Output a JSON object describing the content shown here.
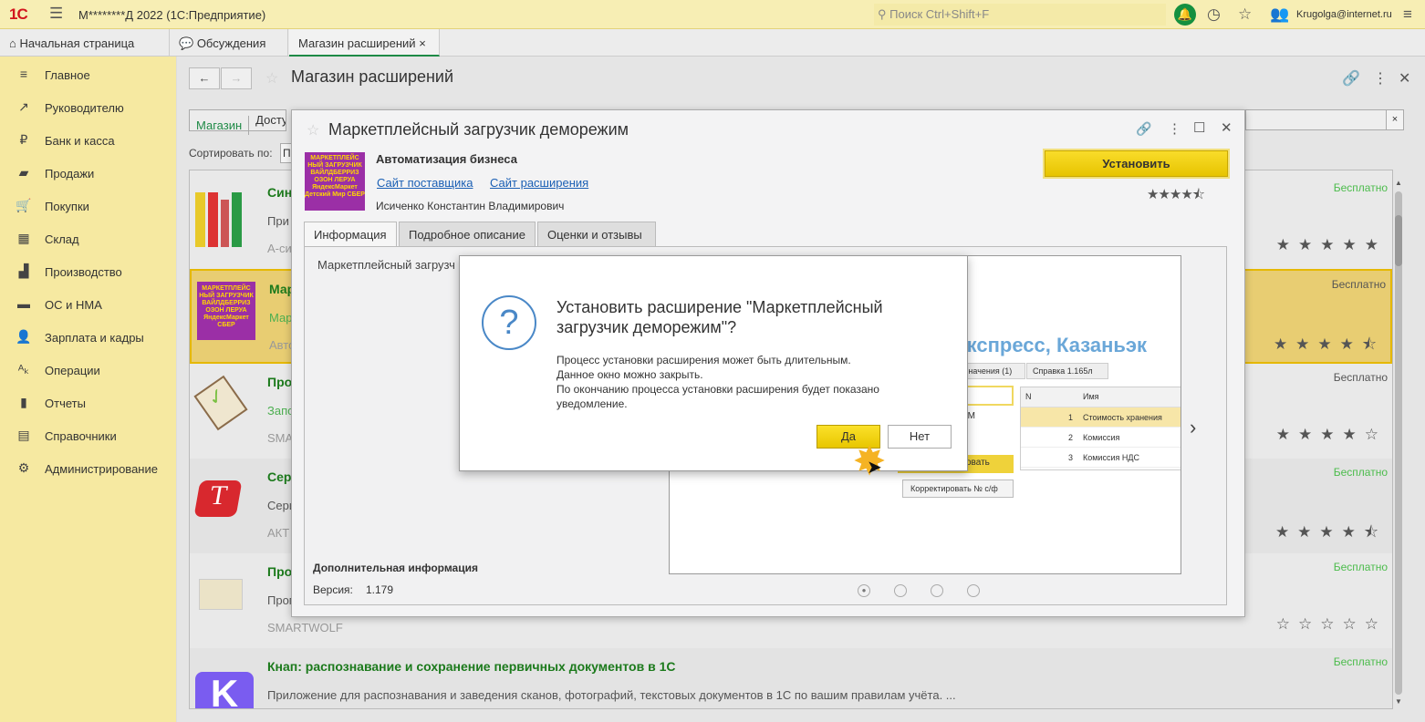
{
  "header": {
    "app_title": "М********Д 2022  (1С:Предприятие)",
    "search_placeholder": "Поиск Ctrl+Shift+F",
    "user": "Krugolga@internet.ru",
    "logo": "1С"
  },
  "tabs": [
    {
      "label": "Начальная страница"
    },
    {
      "label": "Обсуждения"
    },
    {
      "label": "Магазин расширений",
      "close": "×"
    }
  ],
  "sidebar": {
    "items": [
      {
        "label": "Главное",
        "icon": "≡"
      },
      {
        "label": "Руководителю",
        "icon": "↗"
      },
      {
        "label": "Банк и касса",
        "icon": "₽"
      },
      {
        "label": "Продажи",
        "icon": "▰"
      },
      {
        "label": "Покупки",
        "icon": "🛒"
      },
      {
        "label": "Склад",
        "icon": "▦"
      },
      {
        "label": "Производство",
        "icon": "▟"
      },
      {
        "label": "ОС и НМА",
        "icon": "▬"
      },
      {
        "label": "Зарплата и кадры",
        "icon": "👤"
      },
      {
        "label": "Операции",
        "icon": "ᴬₖ"
      },
      {
        "label": "Отчеты",
        "icon": "▮"
      },
      {
        "label": "Справочники",
        "icon": "▤"
      },
      {
        "label": "Администрирование",
        "icon": "⚙"
      }
    ]
  },
  "page": {
    "title": "Магазин расширений",
    "filter_tabs": [
      "Магазин",
      "Досту"
    ],
    "sort_label": "Сортировать по:",
    "sort_value": "П"
  },
  "list": [
    {
      "title": "Син",
      "subtitle": "При",
      "vendor": "А-си",
      "price": "Бесплатно",
      "rating": 5
    },
    {
      "title": "Мар",
      "subtitle": "Мар",
      "vendor": "Авто",
      "price": "Бесплатно",
      "rating": 4.5
    },
    {
      "title": "Про",
      "subtitle": "Запо",
      "vendor": "SMA",
      "price": "Бесплатно",
      "rating": 4
    },
    {
      "title": "Сер",
      "subtitle": "Сери",
      "vendor": "АКТ",
      "price": "Бесплатно",
      "rating": 4.5
    },
    {
      "title": "Про",
      "subtitle": "Прог",
      "vendor": "SMARTWOLF",
      "price": "Бесплатно",
      "rating": 0
    },
    {
      "title": "Кнап: распознавание и сохранение первичных документов в 1С",
      "subtitle": "Приложение для распознавания и заведения сканов, фотографий, текстовых документов в 1С по вашим правилам учёта. ...",
      "vendor": "",
      "price": "Бесплатно"
    }
  ],
  "dialog": {
    "title": "Маркетплейсный загрузчик деморежим",
    "category": "Автоматизация бизнеса",
    "link_vendor": "Сайт поставщика",
    "link_ext": "Сайт расширения",
    "author": "Исиченко Константин Владимирович",
    "install": "Установить",
    "rating": 4.5,
    "thumb_text": "МАРКЕТПЛЕЙС НЫЙ ЗАГРУЗЧИК ВАЙЛДБЕРРИЗ ОЗОН ЛЕРУА ЯндексМаркет Детский Мир СБЕР",
    "tabs": [
      "Информация",
      "Подробное описание",
      "Оценки и отзывы"
    ],
    "info_text": "Маркетплейсный загрузч",
    "extra_title": "Дополнительная информация",
    "version_label": "Версия:",
    "version": "1.179",
    "shot": {
      "banner": "иэкспресс, Казаньэк",
      "tab1": "Значения (1)",
      "tab2": "Справка 1.165л",
      "col_n": "N",
      "col_name": "Имя",
      "rows": [
        {
          "n": "1",
          "name": "Стоимость хранения"
        },
        {
          "n": "2",
          "name": "Комиссия"
        },
        {
          "n": "3",
          "name": "Комиссия НДС"
        }
      ],
      "btn_fix": "Корректировать № с/ф",
      "btn_partial": "овать",
      "field_partial": "PM"
    }
  },
  "confirm": {
    "title": "Установить расширение \"Маркетплейсный загрузчик деморежим\"?",
    "line1": "Процесс установки расширения может быть длительным.",
    "line2": "Данное окно можно закрыть.",
    "line3": "По окончанию процесса установки расширения будет показано",
    "line4": "уведомление.",
    "yes": "Да",
    "no": "Нет"
  }
}
